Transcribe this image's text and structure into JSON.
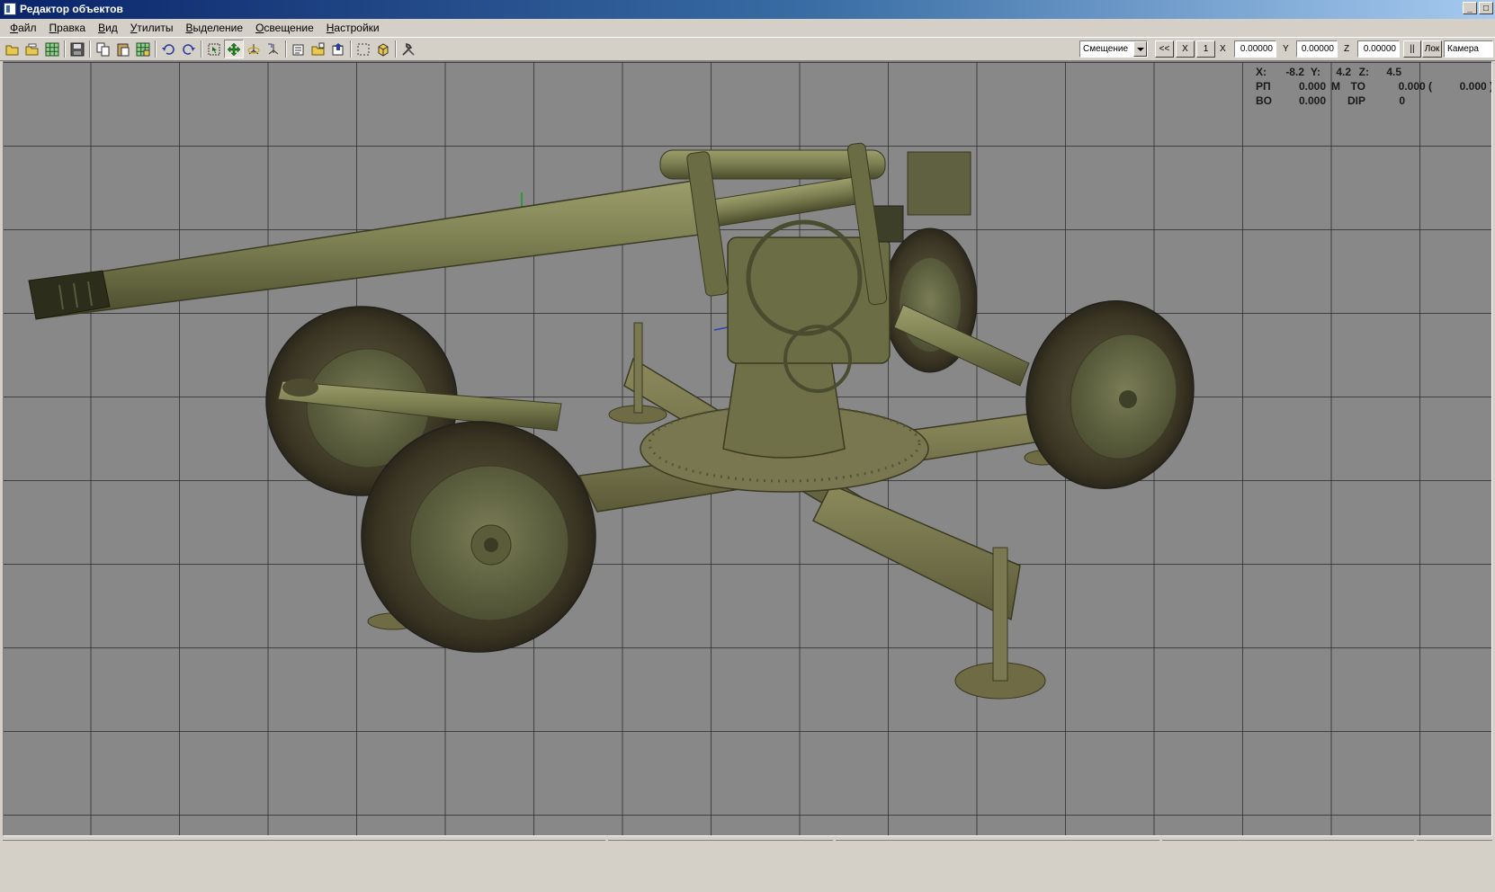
{
  "window": {
    "title": "Редактор объектов"
  },
  "menu": [
    "Файл",
    "Правка",
    "Вид",
    "Утилиты",
    "Выделение",
    "Освещение",
    "Настройки"
  ],
  "toolbar": {
    "mode_select": "Смещение",
    "prev_button": "<<",
    "axis_x_button": "X",
    "axis_1_button": "1",
    "x_label": "X",
    "x_value": "0.00000",
    "y_label": "Y",
    "y_value": "0.00000",
    "z_label": "Z",
    "z_value": "0.00000",
    "pause_button": "||",
    "local_button": "Лок",
    "view_select": "Камера"
  },
  "readout": {
    "x_label": "X:",
    "x_value": "-8.2",
    "y_label": "Y:",
    "y_value": "4.2",
    "z_label": "Z:",
    "z_value": "4.5",
    "rp_label": "РП",
    "rp_value": "0.000",
    "m_label": "M",
    "to_label": "TO",
    "to_value": "0.000 (",
    "to_value2": "0.000 )",
    "bo_label": "BO",
    "bo_value": "0.000",
    "dip_label": "DIP",
    "dip_value": "0"
  },
  "colors": {
    "titlebar_start": "#0a246a",
    "titlebar_end": "#a6caf0",
    "viewport_bg": "#888888",
    "grid": "#333333",
    "model_olive": "#6f7245"
  },
  "viewport_object": "anti-aircraft-gun-model"
}
